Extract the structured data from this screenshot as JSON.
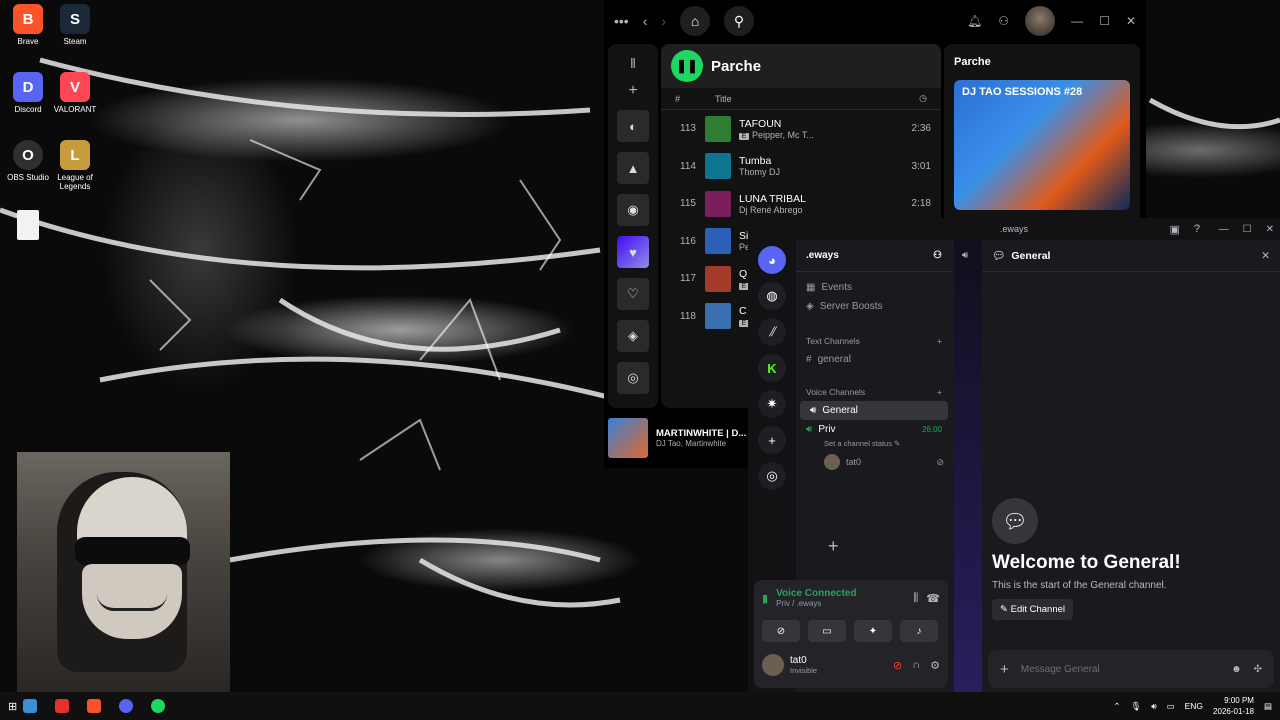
{
  "desktop": {
    "icons": [
      {
        "label": "Brave",
        "color": "#fb542b",
        "glyph": "B"
      },
      {
        "label": "Steam",
        "color": "#1b2838",
        "glyph": "S"
      },
      {
        "label": "Discord",
        "color": "#5865f2",
        "glyph": "D"
      },
      {
        "label": "VALORANT",
        "color": "#ff4655",
        "glyph": "V"
      },
      {
        "label": "OBS Studio",
        "color": "#302e31",
        "glyph": "O"
      },
      {
        "label": "League of Legends",
        "color": "#c89b3c",
        "glyph": "L"
      }
    ]
  },
  "spotify": {
    "playlist_title": "Parche",
    "col_hash": "#",
    "col_title": "Title",
    "tracks": [
      {
        "num": "113",
        "name": "TAFOUN",
        "artist": "Peipper, Mc T...",
        "explicit": true,
        "duration": "2:36",
        "color": "#2e7d32"
      },
      {
        "num": "114",
        "name": "Tumba",
        "artist": "Thomy DJ",
        "explicit": false,
        "duration": "3:01",
        "color": "#0e7490"
      },
      {
        "num": "115",
        "name": "LUNA TRIBAL",
        "artist": "Dj René Abrego",
        "explicit": false,
        "duration": "2:18",
        "color": "#7a1f5c"
      },
      {
        "num": "116",
        "name": "Si",
        "artist": "Pe",
        "explicit": false,
        "duration": "",
        "color": "#2b5fb8"
      },
      {
        "num": "117",
        "name": "Q",
        "artist": "",
        "explicit": true,
        "duration": "",
        "color": "#a33a2a"
      },
      {
        "num": "118",
        "name": "C",
        "artist": "",
        "explicit": true,
        "duration": "",
        "color": "#3a6fb0"
      }
    ],
    "right_panel_title": "Parche",
    "cover_text": "DJ TAO SESSIONS #28",
    "now_playing": {
      "name": "MARTINWHITE | D...",
      "artist": "DJ Tao, Martinwhite"
    }
  },
  "discord": {
    "window_title": ".eways",
    "server_name": ".eways",
    "items": {
      "events": "Events",
      "boosts": "Server Boosts"
    },
    "text_category": "Text Channels",
    "text_channel": "general",
    "voice_category": "Voice Channels",
    "voice_general": "General",
    "voice_priv": "Priv",
    "priv_time": "26:00",
    "priv_status": "Set a channel status",
    "priv_user": "tat0",
    "vc_title": "Voice Connected",
    "vc_sub": "Priv / .eways",
    "me_name": "tat0",
    "me_status": "Invisible",
    "channel_header": "General",
    "welcome_title": "Welcome to General!",
    "welcome_text": "This is the start of the General channel.",
    "edit_label": "Edit Channel",
    "input_placeholder": "Message General"
  },
  "taskbar": {
    "lang": "ENG",
    "time": "9:00 PM",
    "date": "2026-01-18"
  }
}
